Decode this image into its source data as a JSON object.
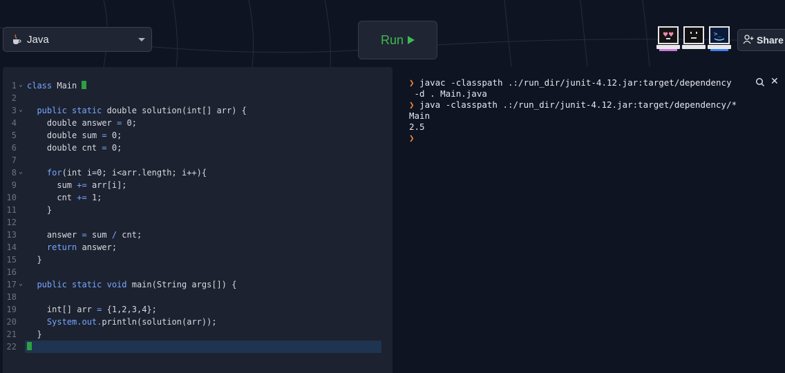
{
  "header": {
    "language": "Java",
    "run_label": "Run",
    "share_label": "Share"
  },
  "editor": {
    "lines": [
      {
        "n": "1",
        "fold": true
      },
      {
        "n": "2",
        "fold": false
      },
      {
        "n": "3",
        "fold": true
      },
      {
        "n": "4",
        "fold": false
      },
      {
        "n": "5",
        "fold": false
      },
      {
        "n": "6",
        "fold": false
      },
      {
        "n": "7",
        "fold": false
      },
      {
        "n": "8",
        "fold": true
      },
      {
        "n": "9",
        "fold": false
      },
      {
        "n": "10",
        "fold": false
      },
      {
        "n": "11",
        "fold": false
      },
      {
        "n": "12",
        "fold": false
      },
      {
        "n": "13",
        "fold": false
      },
      {
        "n": "14",
        "fold": false
      },
      {
        "n": "15",
        "fold": false
      },
      {
        "n": "16",
        "fold": false
      },
      {
        "n": "17",
        "fold": true
      },
      {
        "n": "18",
        "fold": false
      },
      {
        "n": "19",
        "fold": false
      },
      {
        "n": "20",
        "fold": false
      },
      {
        "n": "21",
        "fold": false
      },
      {
        "n": "22",
        "fold": false
      }
    ],
    "code": {
      "l1": [
        "class",
        " Main "
      ],
      "l3": [
        "public static",
        " double solution(int[] arr) {"
      ],
      "l4": [
        "double answer ",
        "=",
        " 0;"
      ],
      "l5": [
        "double sum ",
        "=",
        " 0;"
      ],
      "l6": [
        "double cnt ",
        "=",
        " 0;"
      ],
      "l8": [
        "for",
        "(int i=0; i<arr.length; i++){"
      ],
      "l9": [
        "sum ",
        "+=",
        " arr[i];"
      ],
      "l10": [
        "cnt ",
        "+=",
        " 1;"
      ],
      "l11": "}",
      "l13": [
        "answer ",
        "=",
        " sum ",
        "/",
        " cnt;"
      ],
      "l14": [
        "return",
        " answer;"
      ],
      "l15": "}",
      "l17": [
        "public static void",
        " main(String args[]) {"
      ],
      "l19": [
        "int[] arr ",
        "=",
        " {1,2,3,4};"
      ],
      "l20": [
        "System.out.",
        "println",
        "(solution(arr));"
      ],
      "l21": "}"
    }
  },
  "terminal": {
    "cmd1_a": "javac -classpath .:/run_dir/junit-4.12.jar:target/dependency",
    "cmd1_b": " -d . Main.java",
    "cmd2": "java -classpath .:/run_dir/junit-4.12.jar:target/dependency/*",
    "out1": "Main",
    "out2": "2.5",
    "prompt": "❯"
  },
  "icons": {
    "lang": "java-cup-icon",
    "search": "search-icon",
    "close": "close-icon",
    "share": "add-user-icon"
  },
  "colors": {
    "run": "#3fb950",
    "prompt": "#f0883e",
    "keyword": "#74a7ff"
  }
}
